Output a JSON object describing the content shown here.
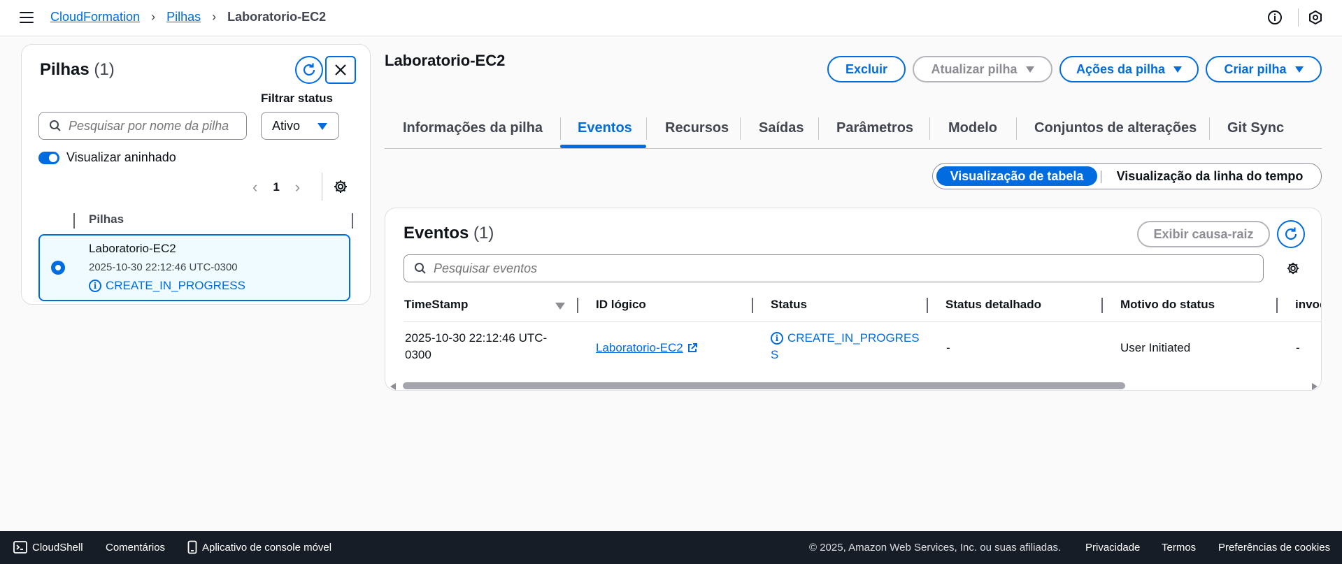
{
  "breadcrumb": {
    "items": [
      "CloudFormation",
      "Pilhas"
    ],
    "current": "Laboratorio-EC2"
  },
  "left_panel": {
    "title": "Pilhas",
    "count": "(1)",
    "search_placeholder": "Pesquisar por nome da pilha",
    "filter_label": "Filtrar status",
    "filter_value": "Ativo",
    "toggle_label": "Visualizar aninhado",
    "toggle_on": true,
    "page": "1",
    "column_header": "Pilhas",
    "stack": {
      "name": "Laboratorio-EC2",
      "date": "2025-10-30 22:12:46 UTC-0300",
      "status": "CREATE_IN_PROGRESS"
    }
  },
  "main": {
    "title": "Laboratorio-EC2",
    "buttons": {
      "delete": "Excluir",
      "update": "Atualizar pilha",
      "actions": "Ações da pilha",
      "create": "Criar pilha"
    },
    "tabs": [
      "Informações da pilha",
      "Eventos",
      "Recursos",
      "Saídas",
      "Parâmetros",
      "Modelo",
      "Conjuntos de alterações",
      "Git Sync"
    ],
    "active_tab": "Eventos",
    "view_toggle": {
      "table": "Visualização de tabela",
      "timeline": "Visualização da linha do tempo"
    }
  },
  "events": {
    "title": "Eventos",
    "count": "(1)",
    "root_cause_button": "Exibir causa-raiz",
    "search_placeholder": "Pesquisar eventos",
    "columns": [
      "TimeStamp",
      "ID lógico",
      "Status",
      "Status detalhado",
      "Motivo do status",
      "invoc"
    ],
    "rows": [
      {
        "timestamp_line1": "2025-10-30 22:12:46 UTC-",
        "timestamp_line2": "0300",
        "logical_id": "Laboratorio-EC2",
        "status_line1": "CREATE_IN_PROGRES",
        "status_line2": "S",
        "detailed_status": "-",
        "status_reason": "User Initiated",
        "invoc": "-"
      }
    ]
  },
  "footer": {
    "cloudshell": "CloudShell",
    "comments": "Comentários",
    "mobile_app": "Aplicativo de console móvel",
    "copyright": "© 2025, Amazon Web Services, Inc. ou suas afiliadas.",
    "privacy": "Privacidade",
    "terms": "Termos",
    "cookies": "Preferências de cookies"
  },
  "colors": {
    "accent": "#006ce0",
    "footer_bg": "#161d26",
    "selected_row_bg": "#f0fbff"
  }
}
